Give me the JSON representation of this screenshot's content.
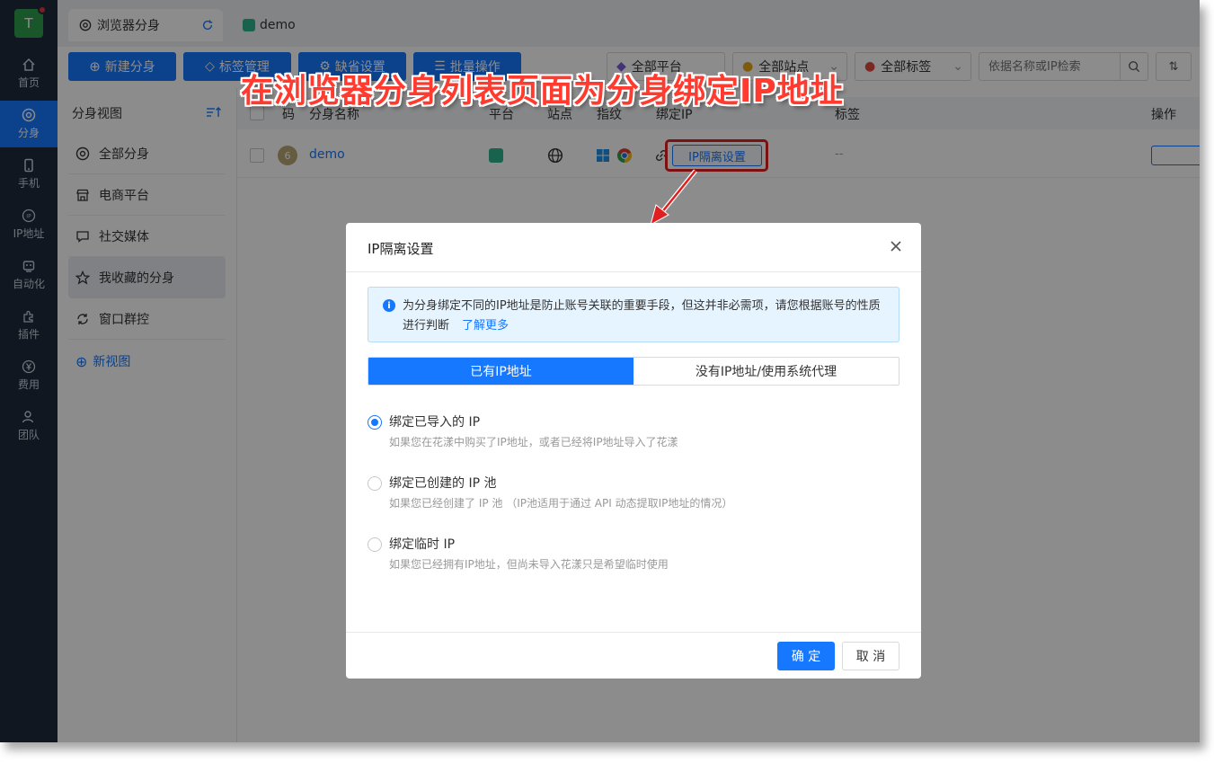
{
  "rail": {
    "avatar_letter": "T",
    "items": [
      {
        "label": "首页",
        "icon": "home-icon"
      },
      {
        "label": "分身",
        "icon": "chrome-icon"
      },
      {
        "label": "手机",
        "icon": "phone-icon"
      },
      {
        "label": "IP地址",
        "icon": "ip-icon"
      },
      {
        "label": "自动化",
        "icon": "robot-icon"
      },
      {
        "label": "插件",
        "icon": "puzzle-icon"
      },
      {
        "label": "费用",
        "icon": "yen-icon"
      },
      {
        "label": "团队",
        "icon": "user-icon"
      }
    ]
  },
  "tabs": [
    {
      "label": "浏览器分身",
      "icon": "chrome-icon"
    },
    {
      "label": "demo",
      "icon": "profile-icon"
    }
  ],
  "toolbar": {
    "new_profile": "新建分身",
    "tag_manage": "标签管理",
    "defaults": "缺省设置",
    "batch": "批量操作",
    "platform_filter": "全部平台",
    "site_filter": "全部站点",
    "tag_filter": "全部标签",
    "search_placeholder": "依据名称或IP检索"
  },
  "views": {
    "title": "分身视图",
    "items": [
      "全部分身",
      "电商平台",
      "社交媒体",
      "我收藏的分身",
      "窗口群控"
    ],
    "new_view": "新视图"
  },
  "table": {
    "headers": [
      "码",
      "分身名称",
      "平台",
      "站点",
      "指纹",
      "绑定IP",
      "标签",
      "操作"
    ],
    "row": {
      "num": "6",
      "name": "demo",
      "ip_button": "IP隔离设置",
      "tag": "--"
    }
  },
  "annotation": "在浏览器分身列表页面为分身绑定IP地址",
  "modal": {
    "title": "IP隔离设置",
    "alert_text": "为分身绑定不同的IP地址是防止账号关联的重要手段，但这并非必需项，请您根据账号的性质进行判断",
    "alert_link": "了解更多",
    "tabs": [
      "已有IP地址",
      "没有IP地址/使用系统代理"
    ],
    "options": [
      {
        "label": "绑定已导入的 IP",
        "desc": "如果您在花漾中购买了IP地址，或者已经将IP地址导入了花漾"
      },
      {
        "label": "绑定已创建的 IP 池",
        "desc": "如果您已经创建了 IP 池 （IP池适用于通过 API 动态提取IP地址的情况）"
      },
      {
        "label": "绑定临时 IP",
        "desc": "如果您已经拥有IP地址，但尚未导入花漾只是希望临时使用"
      }
    ],
    "confirm": "确 定",
    "cancel": "取 消"
  },
  "colors": {
    "primary": "#1677ff",
    "rail_bg": "#1f2a3c",
    "annotation": "#ff3b2f"
  }
}
